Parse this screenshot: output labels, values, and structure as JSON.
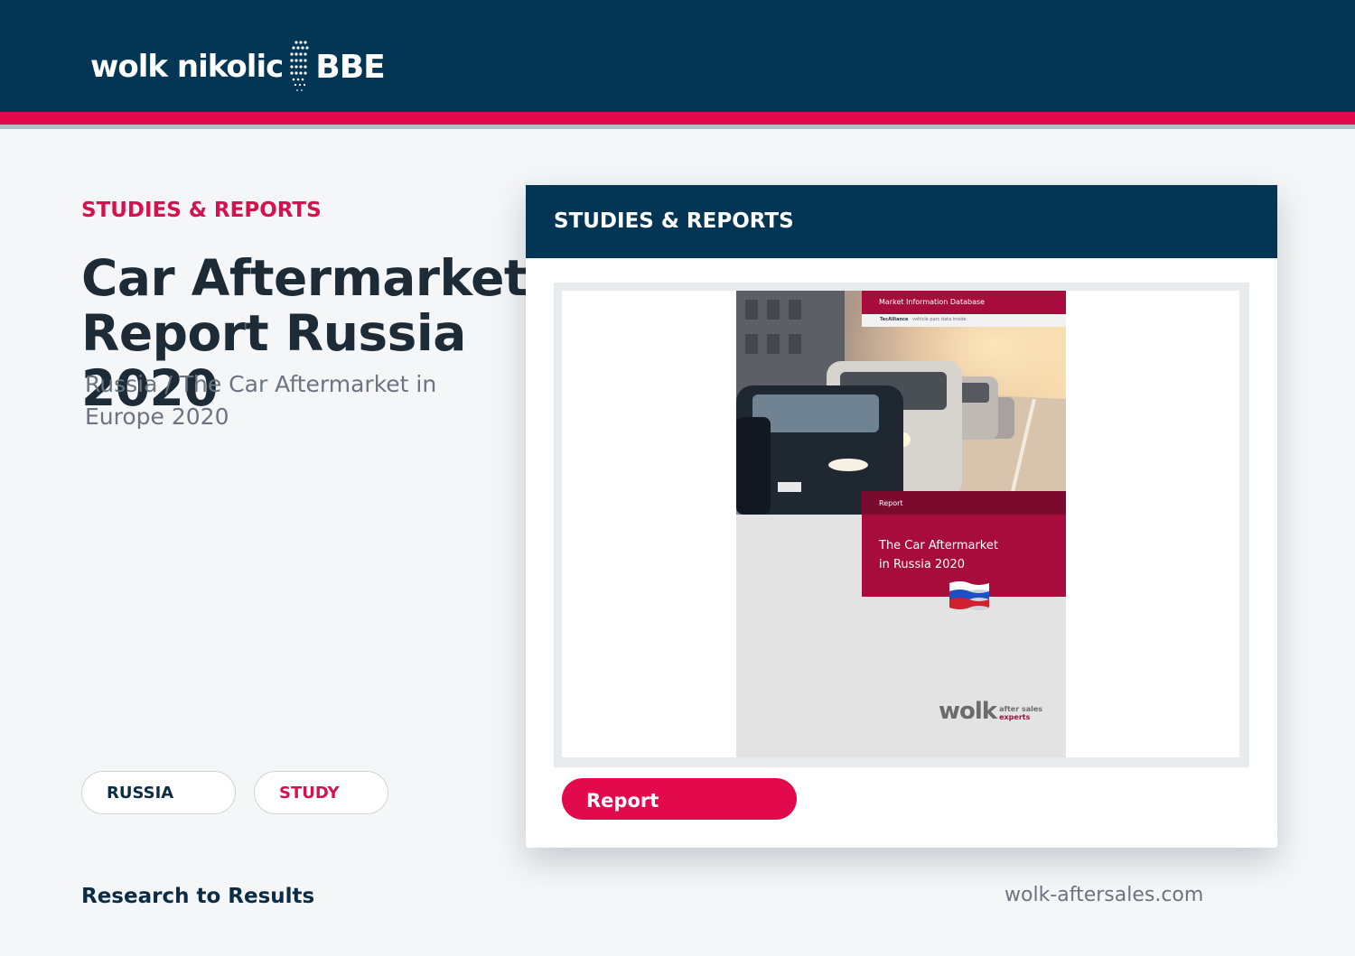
{
  "header": {
    "logo": {
      "wordmark": "wolk nikolic",
      "brand": "BBE"
    },
    "colors": {
      "navy": "#033655",
      "accent": "#e20a4c"
    }
  },
  "hero": {
    "kicker": "STUDIES & REPORTS",
    "title_line1": "Car Aftermarket",
    "title_line2": "Report Russia 2020",
    "subtitle_line1": "Russia / The Car Aftermarket in",
    "subtitle_line2": "Europe 2020"
  },
  "tags": [
    {
      "label": "RUSSIA"
    },
    {
      "label": "STUDY"
    }
  ],
  "footer": {
    "tagline": "Research to Results",
    "website": "wolk-aftersales.com"
  },
  "card": {
    "title": "STUDIES & REPORTS",
    "cover": {
      "top_label": "Market Information Database",
      "strip_brand": "TecAlliance",
      "strip_text": "vehicle parc data inside",
      "section_label": "Report",
      "title_line1": "The Car Aftermarket",
      "title_line2": "in Russia 2020",
      "flag_icon": "russia-flag-icon",
      "logo_wordmark": "wolk",
      "logo_tag_line1": "after sales",
      "logo_tag_line2": "experts"
    },
    "button_label": "Report"
  }
}
